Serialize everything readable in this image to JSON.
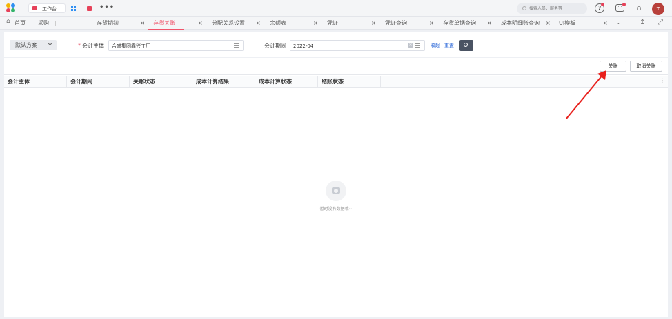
{
  "topbar": {
    "workspace_label": "工作台",
    "more_label": "•••",
    "search_placeholder": "搜索人员、服务等",
    "avatar_initial": "T"
  },
  "tabs": [
    {
      "label": "首页",
      "closable": false
    },
    {
      "label": "采购",
      "closable": false
    },
    {
      "label": "存货期初",
      "closable": true
    },
    {
      "label": "存货关账",
      "closable": true,
      "active": true
    },
    {
      "label": "分配关系设置",
      "closable": true
    },
    {
      "label": "余额表",
      "closable": true
    },
    {
      "label": "凭证",
      "closable": true
    },
    {
      "label": "凭证查询",
      "closable": true
    },
    {
      "label": "存货单据查询",
      "closable": true
    },
    {
      "label": "成本明细账查询",
      "closable": true
    },
    {
      "label": "UI模板",
      "closable": true
    }
  ],
  "tab_close_glyph": "×",
  "filter": {
    "scheme_label": "默认方案",
    "entity_label": "会计主体",
    "entity_value": "合盛集团鑫兴工厂",
    "period_label": "会计期间",
    "period_value": "2022-04",
    "fold_label": "收起",
    "reset_label": "重置"
  },
  "actions": {
    "close_label": "关账",
    "cancel_close_label": "取消关账"
  },
  "table": {
    "columns": [
      "会计主体",
      "会计期间",
      "关账状态",
      "成本计算结果",
      "成本计算状态",
      "结账状态"
    ],
    "rows": []
  },
  "empty_text": "暂时没有数据哦~",
  "colors": {
    "accent": "#f0546b",
    "annotation_arrow": "#e8201c",
    "search_button": "#4a5363",
    "link": "#1f5fd6"
  }
}
